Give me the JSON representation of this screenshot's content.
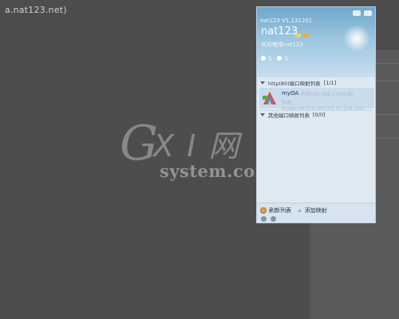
{
  "background": {
    "top_text": "a.nat123.net)"
  },
  "watermark": {
    "big": "G",
    "mid": "X I 网",
    "sub": "system.com"
  },
  "app": {
    "version": "nat123 V1.131201",
    "username": "nat123",
    "greeting": "欢迎使用nat123",
    "stat1": "1",
    "stat2": "1",
    "http_section": "http(80)端口映射列表",
    "http_count": "[1/1]",
    "mapping": {
      "name": "myOA",
      "inner": "内网192.168.1.240:80",
      "outer": "外网myoa.nat123.net[113.10.156.162]"
    },
    "other_section": "其他端口映射列表",
    "other_count": "[0/0]",
    "footer": {
      "refresh": "刷新列表",
      "add": "添加映射"
    }
  }
}
